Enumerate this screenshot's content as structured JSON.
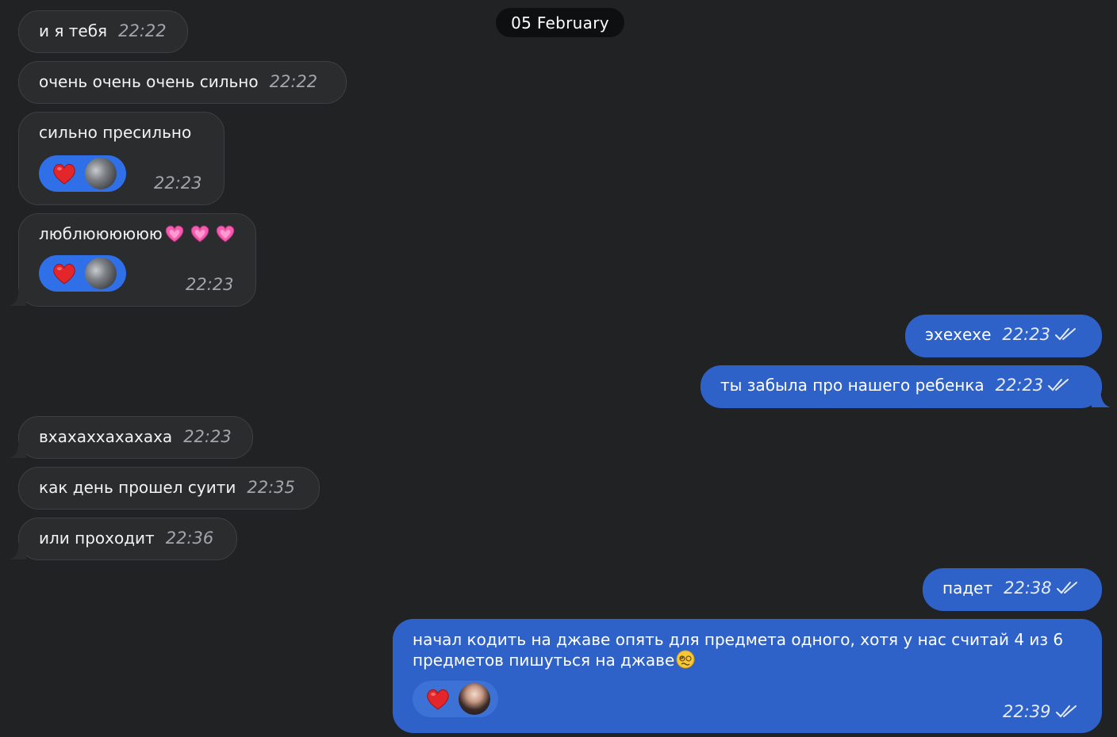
{
  "date_separator": "05 February",
  "messages": [
    {
      "text": "и я тебя",
      "time": "22:22"
    },
    {
      "text": "очень очень очень сильно",
      "time": "22:22"
    },
    {
      "text": "сильно пресильно",
      "time": "22:23",
      "reaction": "heart"
    },
    {
      "text": "люблюююююю",
      "emoji": "pink-heart-icon x3",
      "time": "22:23",
      "reaction": "heart"
    },
    {
      "text": "эхехехе",
      "time": "22:23",
      "read": true
    },
    {
      "text": "ты забыла про нашего ребенка",
      "time": "22:23",
      "read": true
    },
    {
      "text": "вхахаххахахаха",
      "time": "22:23"
    },
    {
      "text": "как день прошел суити",
      "time": "22:35"
    },
    {
      "text": "или проходит",
      "time": "22:36"
    },
    {
      "text": "падет",
      "time": "22:38",
      "read": true
    },
    {
      "text_line1": "начал кодить на джаве опять для предмета одного, хотя у нас считай 4 из 6",
      "text_line2": "предметов пишуться на джаве",
      "emoji": "woozy-face-icon",
      "time": "22:39",
      "read": true,
      "reaction": "heart"
    }
  ],
  "colors": {
    "background": "#212224",
    "incoming_bubble": "#2b2c2e",
    "outgoing_bubble": "#2f62c9",
    "reaction_pill": "#2f6fe8"
  }
}
